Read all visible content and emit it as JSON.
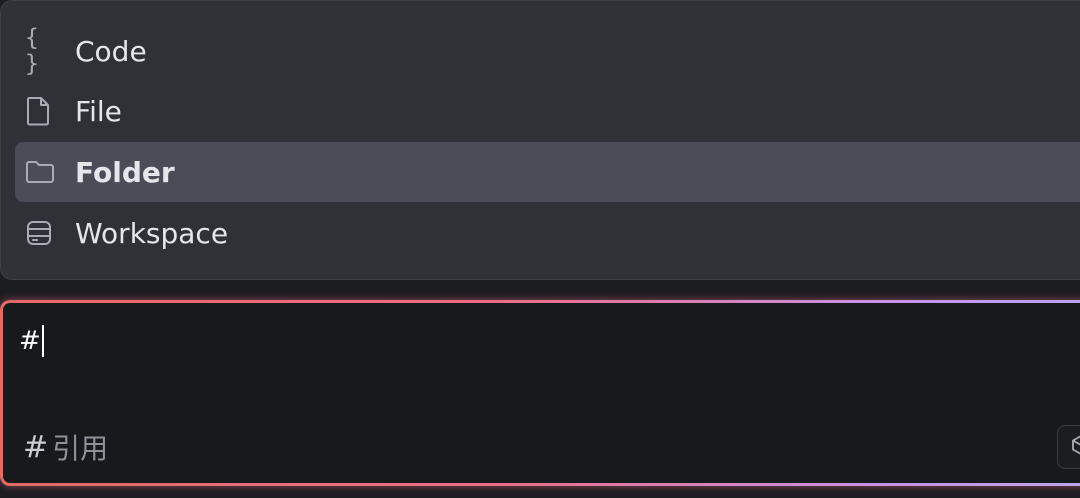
{
  "menu": {
    "items": [
      {
        "label": "Code",
        "icon": "code-braces-icon",
        "selected": false
      },
      {
        "label": "File",
        "icon": "file-icon",
        "selected": false
      },
      {
        "label": "Folder",
        "icon": "folder-icon",
        "selected": true
      },
      {
        "label": "Workspace",
        "icon": "workspace-database-icon",
        "selected": false
      }
    ]
  },
  "input": {
    "value": "#"
  },
  "footer": {
    "reference_hash": "#",
    "reference_label": "引用",
    "cube_icon": "cube-icon"
  },
  "colors": {
    "panel_bg": "#2f3137",
    "selected_bg": "#4a4d57",
    "input_bg": "#18191d",
    "gradient_start": "#e46a66",
    "gradient_end": "#b9a4f0"
  }
}
